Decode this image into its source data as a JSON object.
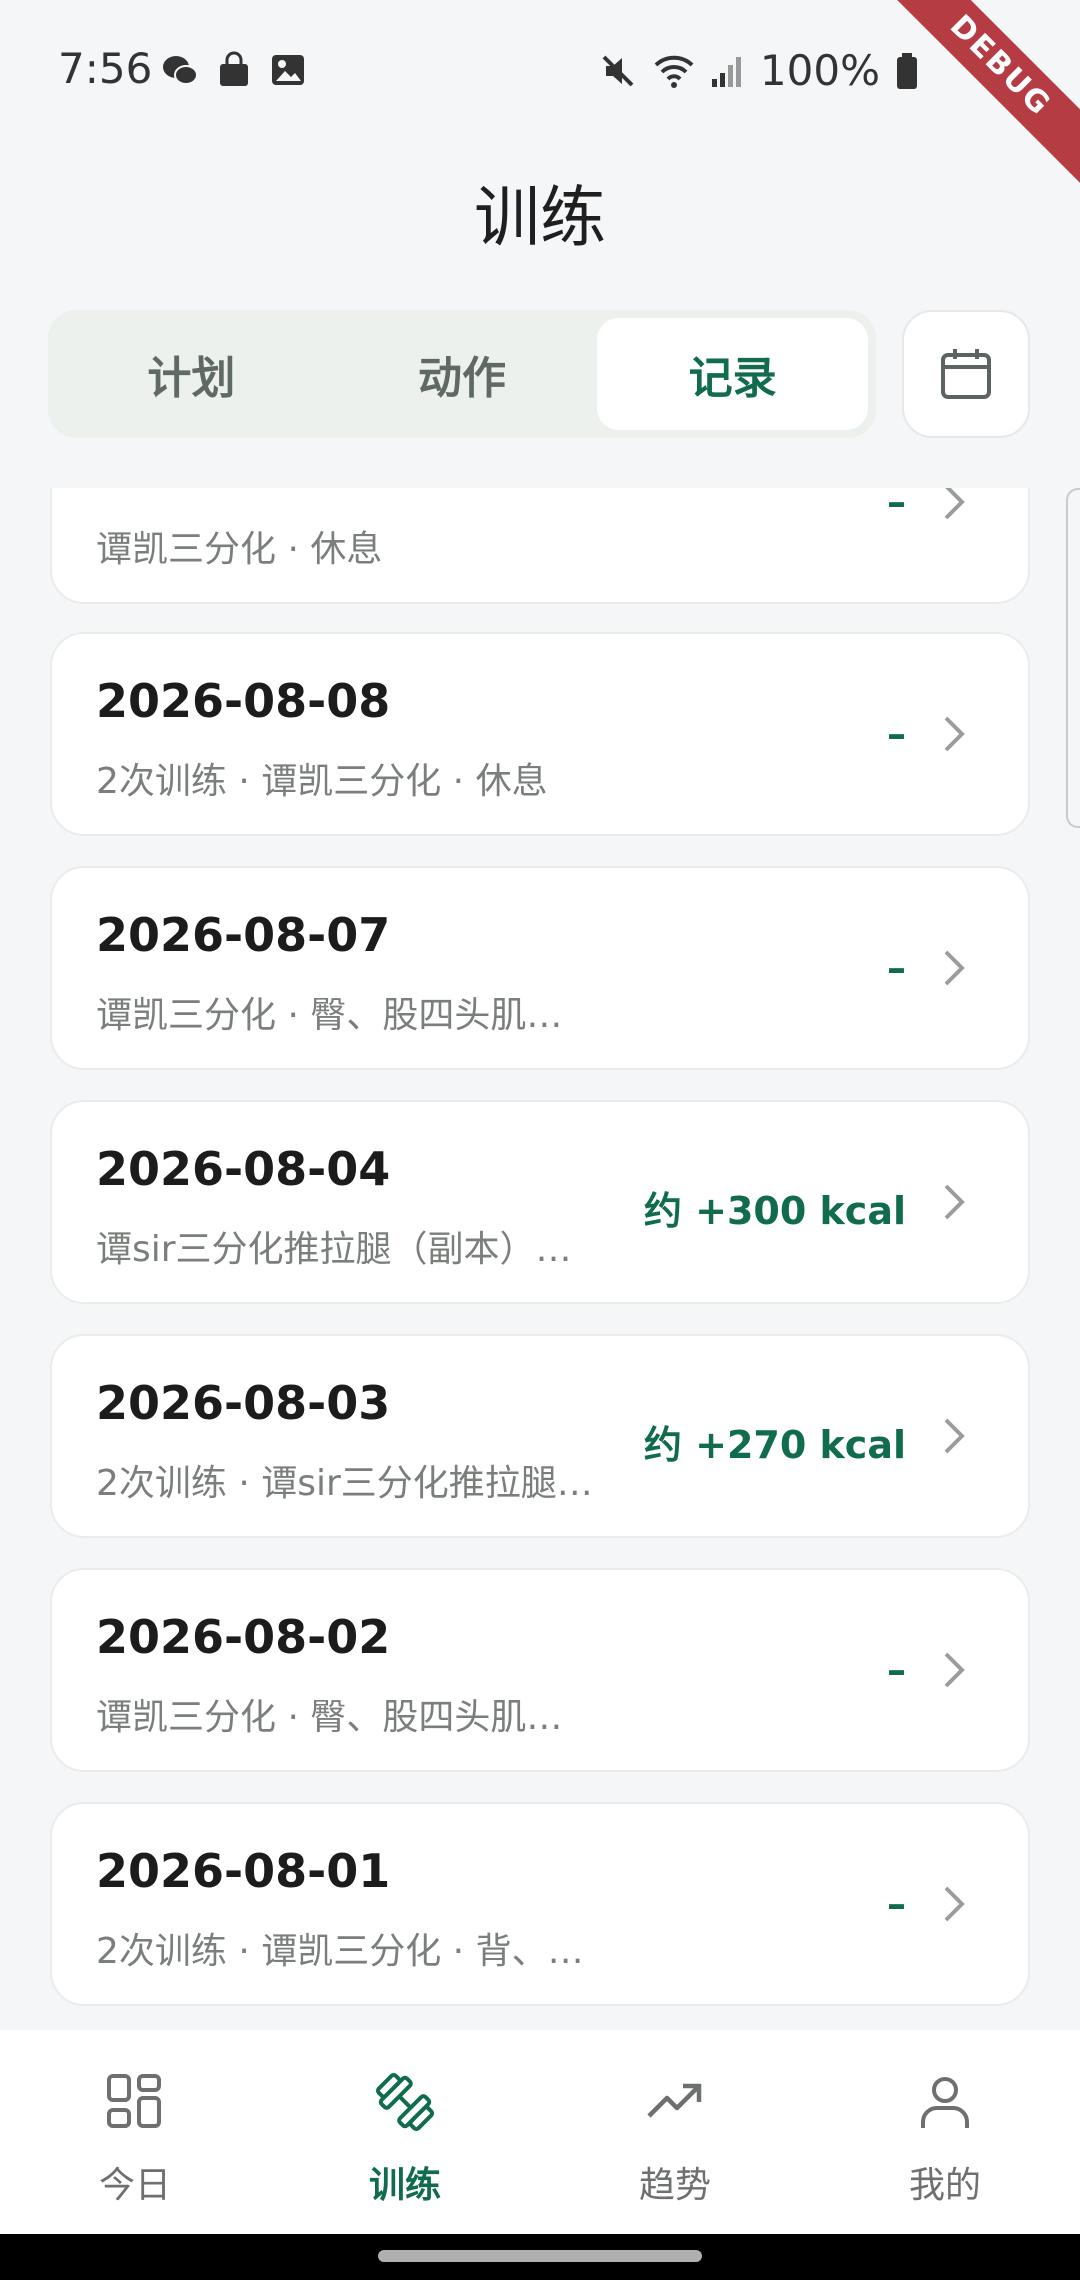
{
  "status_bar": {
    "time": "7:56",
    "battery": "100%",
    "left_icons": [
      "wechat-icon",
      "shopping-bag-icon",
      "image-icon"
    ],
    "right_icons": [
      "mute-icon",
      "wifi-icon",
      "signal-icon",
      "battery-icon"
    ]
  },
  "debug_ribbon": "DEBUG",
  "app_bar": {
    "title": "训练"
  },
  "tabs": [
    {
      "label": "计划",
      "active": false
    },
    {
      "label": "动作",
      "active": false
    },
    {
      "label": "记录",
      "active": true
    }
  ],
  "records": [
    {
      "date": "",
      "subtitle": "谭凯三分化 · 休息",
      "value": "–"
    },
    {
      "date": "2026-08-08",
      "subtitle": "2次训练 · 谭凯三分化 · 休息",
      "value": "–"
    },
    {
      "date": "2026-08-07",
      "subtitle": "谭凯三分化 · 臀、股四头肌…",
      "value": "–"
    },
    {
      "date": "2026-08-04",
      "subtitle": "谭sir三分化推拉腿（副本）…",
      "value": "约 +300 kcal"
    },
    {
      "date": "2026-08-03",
      "subtitle": "2次训练 · 谭sir三分化推拉腿…",
      "value": "约 +270 kcal"
    },
    {
      "date": "2026-08-02",
      "subtitle": "谭凯三分化 · 臀、股四头肌…",
      "value": "–"
    },
    {
      "date": "2026-08-01",
      "subtitle": "2次训练 · 谭凯三分化 · 背、…",
      "value": "–"
    }
  ],
  "bottom_nav": [
    {
      "label": "今日",
      "icon": "grid-icon",
      "active": false
    },
    {
      "label": "训练",
      "icon": "dumbbell-icon",
      "active": true
    },
    {
      "label": "趋势",
      "icon": "trending-up-icon",
      "active": false
    },
    {
      "label": "我的",
      "icon": "person-icon",
      "active": false
    }
  ],
  "colors": {
    "accent": "#116b4f",
    "background": "#f4f6f8",
    "card": "#ffffff",
    "debug": "#b63c43"
  }
}
